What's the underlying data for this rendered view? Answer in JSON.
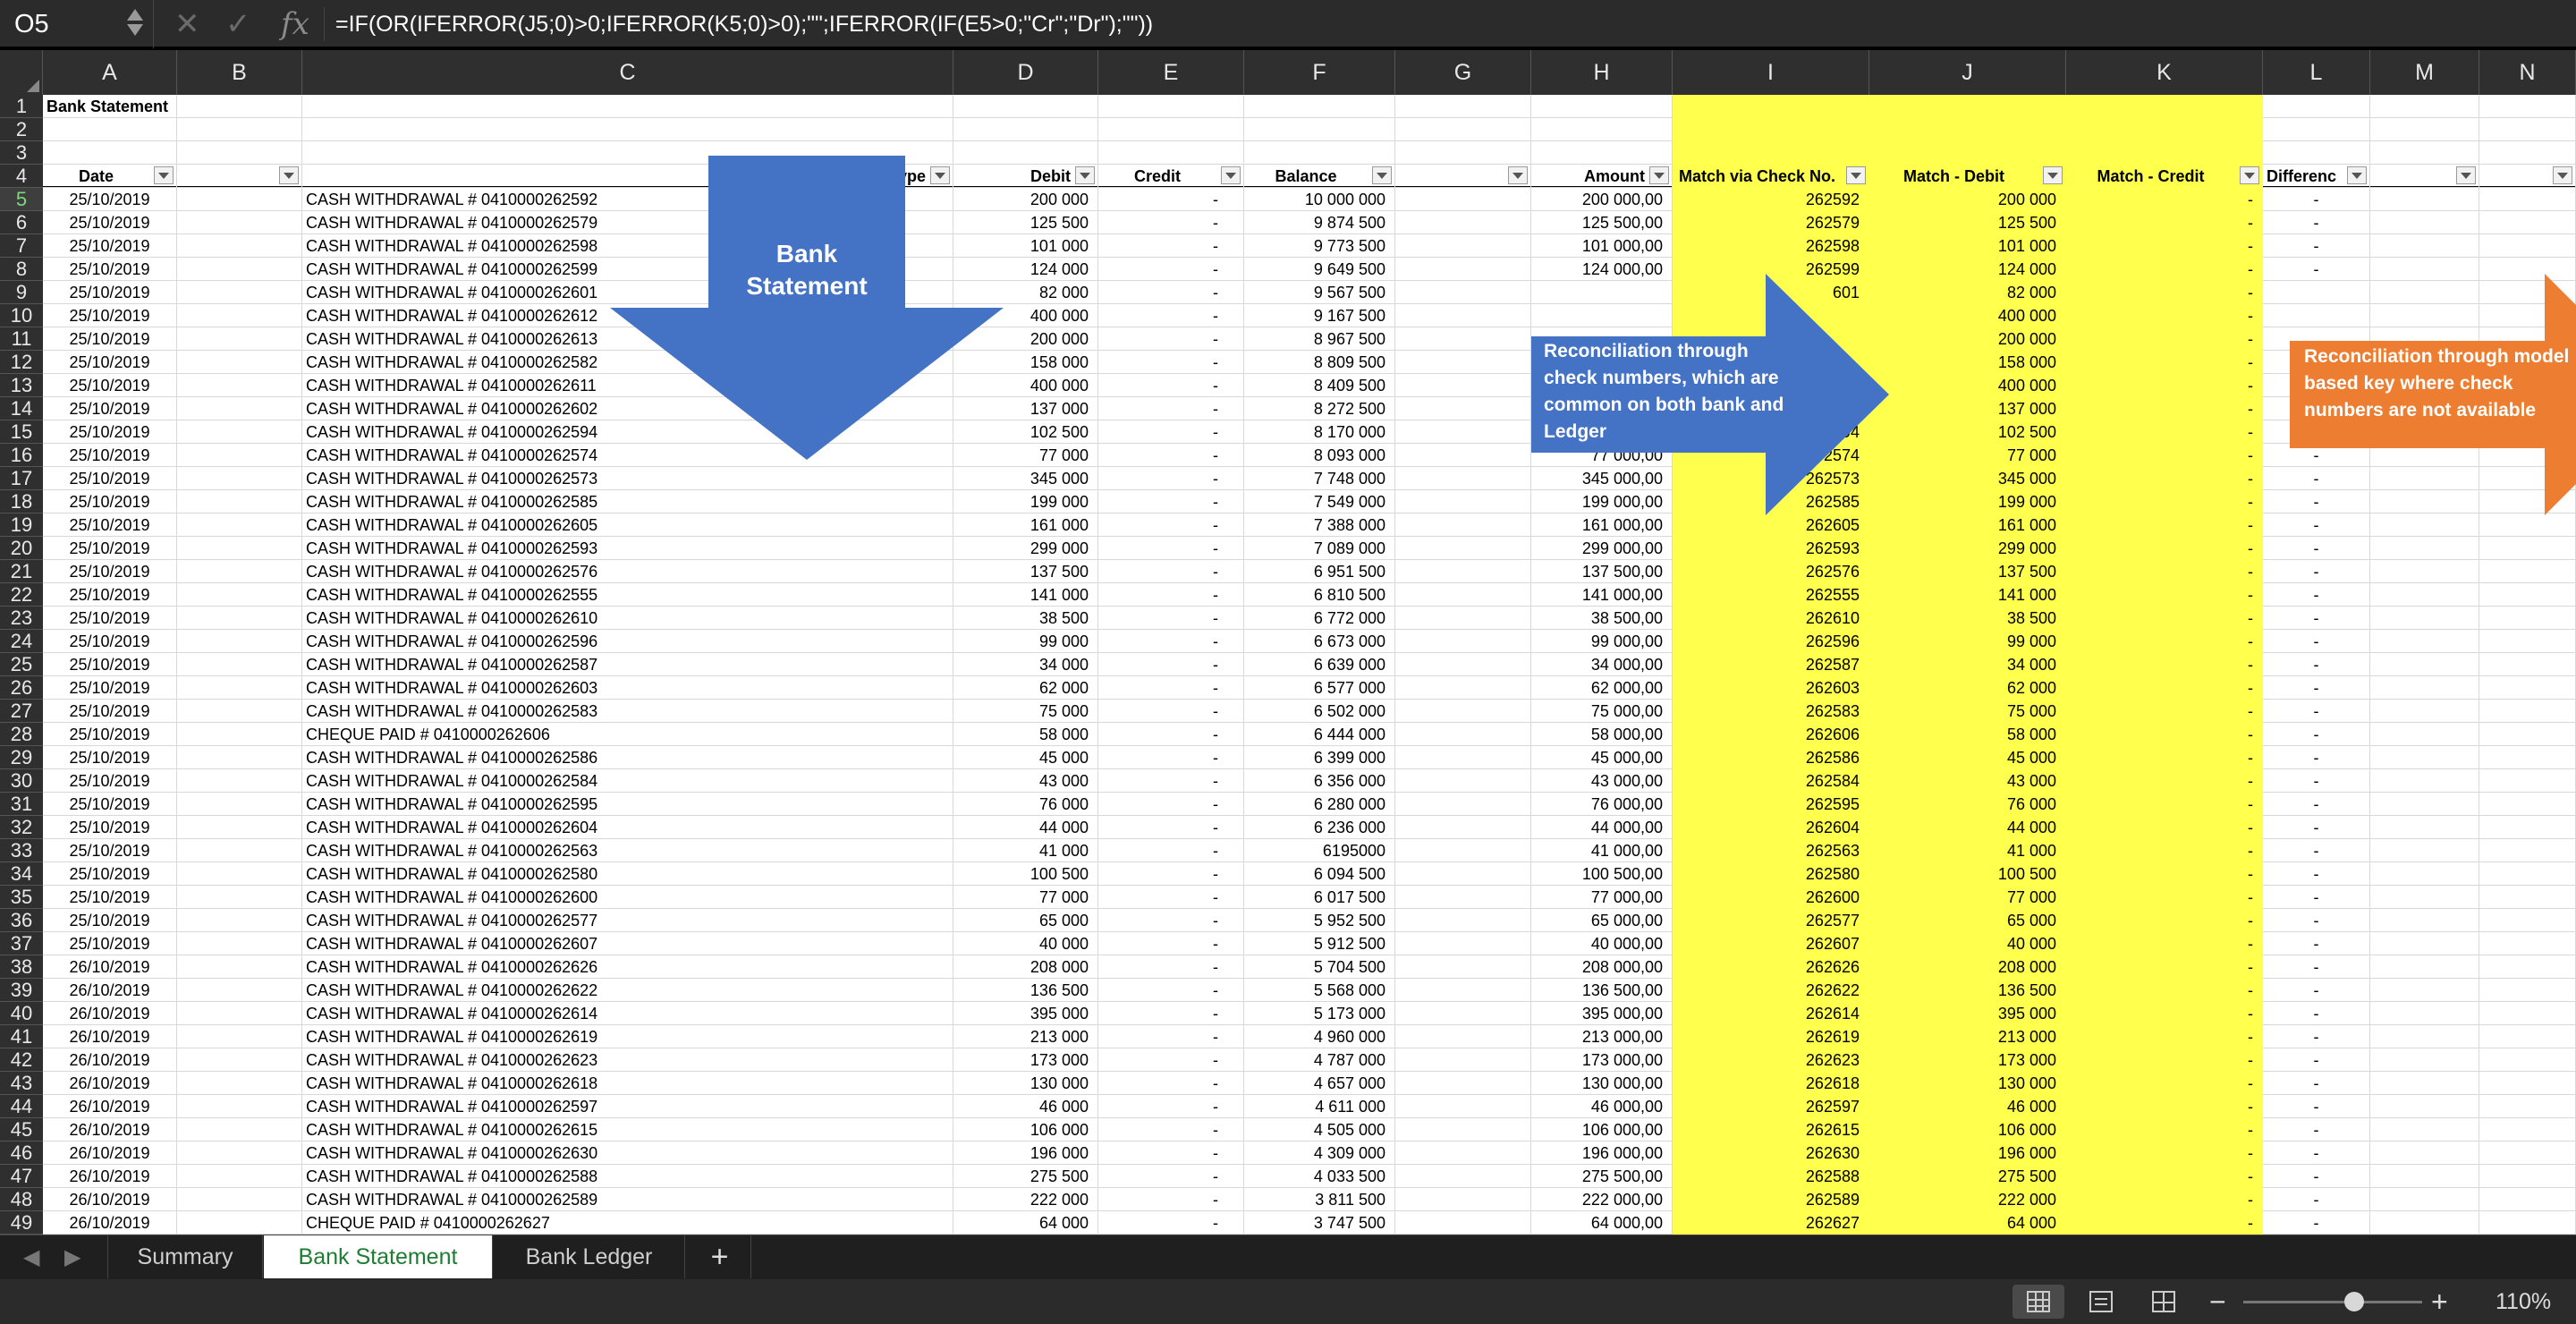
{
  "formula_bar": {
    "name_box": "O5",
    "formula": "=IF(OR(IFERROR(J5;0)>0;IFERROR(K5;0)>0);\"\";IFERROR(IF(E5>0;\"Cr\";\"Dr\");\"\"))"
  },
  "icons": {
    "cancel": "✕",
    "enter": "✓",
    "fx": "fx",
    "prev": "◀",
    "next": "▶",
    "add": "+",
    "zoom_out": "−",
    "zoom_in": "+"
  },
  "columns": [
    "A",
    "B",
    "C",
    "D",
    "E",
    "F",
    "G",
    "H",
    "I",
    "J",
    "K",
    "L",
    "M",
    "N"
  ],
  "active_cell": "O5",
  "title_cell": "Bank Statement",
  "headers": {
    "date": "Date",
    "transaction_type": "Transaction Type",
    "debit": "Debit",
    "credit": "Credit",
    "balance": "Balance",
    "amount": "Amount",
    "match_check": "Match via Check No.",
    "match_debit": "Match - Debit",
    "match_credit": "Match - Credit",
    "difference": "Differenc"
  },
  "rows": [
    {
      "r": "5",
      "date": "25/10/2019",
      "desc": "CASH WITHDRAWAL # 0410000262592",
      "debit": "200 000",
      "credit": "-",
      "balance": "10 000 000",
      "amount": "200 000,00",
      "check": "262592",
      "mdebit": "200 000",
      "mcredit": "-",
      "diff": "-"
    },
    {
      "r": "6",
      "date": "25/10/2019",
      "desc": "CASH WITHDRAWAL # 0410000262579",
      "debit": "125 500",
      "credit": "-",
      "balance": "9 874 500",
      "amount": "125 500,00",
      "check": "262579",
      "mdebit": "125 500",
      "mcredit": "-",
      "diff": "-"
    },
    {
      "r": "7",
      "date": "25/10/2019",
      "desc": "CASH WITHDRAWAL # 0410000262598",
      "debit": "101 000",
      "credit": "-",
      "balance": "9 773 500",
      "amount": "101 000,00",
      "check": "262598",
      "mdebit": "101 000",
      "mcredit": "-",
      "diff": "-"
    },
    {
      "r": "8",
      "date": "25/10/2019",
      "desc": "CASH WITHDRAWAL # 0410000262599",
      "debit": "124 000",
      "credit": "-",
      "balance": "9 649 500",
      "amount": "124 000,00",
      "check": "262599",
      "mdebit": "124 000",
      "mcredit": "-",
      "diff": "-"
    },
    {
      "r": "9",
      "date": "25/10/2019",
      "desc": "CASH WITHDRAWAL # 0410000262601",
      "debit": "82 000",
      "credit": "-",
      "balance": "9 567 500",
      "amount": "",
      "check": "601",
      "mdebit": "82 000",
      "mcredit": "-",
      "diff": ""
    },
    {
      "r": "10",
      "date": "25/10/2019",
      "desc": "CASH WITHDRAWAL # 0410000262612",
      "debit": "400 000",
      "credit": "-",
      "balance": "9 167 500",
      "amount": "",
      "check": "",
      "mdebit": "400 000",
      "mcredit": "-",
      "diff": ""
    },
    {
      "r": "11",
      "date": "25/10/2019",
      "desc": "CASH WITHDRAWAL # 0410000262613",
      "debit": "200 000",
      "credit": "-",
      "balance": "8 967 500",
      "amount": "",
      "check": "",
      "mdebit": "200 000",
      "mcredit": "-",
      "diff": ""
    },
    {
      "r": "12",
      "date": "25/10/2019",
      "desc": "CASH WITHDRAWAL # 0410000262582",
      "debit": "158 000",
      "credit": "-",
      "balance": "8 809 500",
      "amount": "",
      "check": "",
      "mdebit": "158 000",
      "mcredit": "-",
      "diff": ""
    },
    {
      "r": "13",
      "date": "25/10/2019",
      "desc": "CASH WITHDRAWAL # 0410000262611",
      "debit": "400 000",
      "credit": "-",
      "balance": "8 409 500",
      "amount": "",
      "check": "611",
      "mdebit": "400 000",
      "mcredit": "-",
      "diff": ""
    },
    {
      "r": "14",
      "date": "25/10/2019",
      "desc": "CASH WITHDRAWAL # 0410000262602",
      "debit": "137 000",
      "credit": "-",
      "balance": "8 272 500",
      "amount": "137 000,00",
      "check": "262602",
      "mdebit": "137 000",
      "mcredit": "-",
      "diff": "-"
    },
    {
      "r": "15",
      "date": "25/10/2019",
      "desc": "CASH WITHDRAWAL # 0410000262594",
      "debit": "102 500",
      "credit": "-",
      "balance": "8 170 000",
      "amount": "102 500,00",
      "check": "262594",
      "mdebit": "102 500",
      "mcredit": "-",
      "diff": "-"
    },
    {
      "r": "16",
      "date": "25/10/2019",
      "desc": "CASH WITHDRAWAL # 0410000262574",
      "debit": "77 000",
      "credit": "-",
      "balance": "8 093 000",
      "amount": "77 000,00",
      "check": "262574",
      "mdebit": "77 000",
      "mcredit": "-",
      "diff": "-"
    },
    {
      "r": "17",
      "date": "25/10/2019",
      "desc": "CASH WITHDRAWAL # 0410000262573",
      "debit": "345 000",
      "credit": "-",
      "balance": "7 748 000",
      "amount": "345 000,00",
      "check": "262573",
      "mdebit": "345 000",
      "mcredit": "-",
      "diff": "-"
    },
    {
      "r": "18",
      "date": "25/10/2019",
      "desc": "CASH WITHDRAWAL # 0410000262585",
      "debit": "199 000",
      "credit": "-",
      "balance": "7 549 000",
      "amount": "199 000,00",
      "check": "262585",
      "mdebit": "199 000",
      "mcredit": "-",
      "diff": "-"
    },
    {
      "r": "19",
      "date": "25/10/2019",
      "desc": "CASH WITHDRAWAL # 0410000262605",
      "debit": "161 000",
      "credit": "-",
      "balance": "7 388 000",
      "amount": "161 000,00",
      "check": "262605",
      "mdebit": "161 000",
      "mcredit": "-",
      "diff": "-"
    },
    {
      "r": "20",
      "date": "25/10/2019",
      "desc": "CASH WITHDRAWAL # 0410000262593",
      "debit": "299 000",
      "credit": "-",
      "balance": "7 089 000",
      "amount": "299 000,00",
      "check": "262593",
      "mdebit": "299 000",
      "mcredit": "-",
      "diff": "-"
    },
    {
      "r": "21",
      "date": "25/10/2019",
      "desc": "CASH WITHDRAWAL # 0410000262576",
      "debit": "137 500",
      "credit": "-",
      "balance": "6 951 500",
      "amount": "137 500,00",
      "check": "262576",
      "mdebit": "137 500",
      "mcredit": "-",
      "diff": "-"
    },
    {
      "r": "22",
      "date": "25/10/2019",
      "desc": "CASH WITHDRAWAL # 0410000262555",
      "debit": "141 000",
      "credit": "-",
      "balance": "6 810 500",
      "amount": "141 000,00",
      "check": "262555",
      "mdebit": "141 000",
      "mcredit": "-",
      "diff": "-"
    },
    {
      "r": "23",
      "date": "25/10/2019",
      "desc": "CASH WITHDRAWAL # 0410000262610",
      "debit": "38 500",
      "credit": "-",
      "balance": "6 772 000",
      "amount": "38 500,00",
      "check": "262610",
      "mdebit": "38 500",
      "mcredit": "-",
      "diff": "-"
    },
    {
      "r": "24",
      "date": "25/10/2019",
      "desc": "CASH WITHDRAWAL # 0410000262596",
      "debit": "99 000",
      "credit": "-",
      "balance": "6 673 000",
      "amount": "99 000,00",
      "check": "262596",
      "mdebit": "99 000",
      "mcredit": "-",
      "diff": "-"
    },
    {
      "r": "25",
      "date": "25/10/2019",
      "desc": "CASH WITHDRAWAL # 0410000262587",
      "debit": "34 000",
      "credit": "-",
      "balance": "6 639 000",
      "amount": "34 000,00",
      "check": "262587",
      "mdebit": "34 000",
      "mcredit": "-",
      "diff": "-"
    },
    {
      "r": "26",
      "date": "25/10/2019",
      "desc": "CASH WITHDRAWAL # 0410000262603",
      "debit": "62 000",
      "credit": "-",
      "balance": "6 577 000",
      "amount": "62 000,00",
      "check": "262603",
      "mdebit": "62 000",
      "mcredit": "-",
      "diff": "-"
    },
    {
      "r": "27",
      "date": "25/10/2019",
      "desc": "CASH WITHDRAWAL # 0410000262583",
      "debit": "75 000",
      "credit": "-",
      "balance": "6 502 000",
      "amount": "75 000,00",
      "check": "262583",
      "mdebit": "75 000",
      "mcredit": "-",
      "diff": "-"
    },
    {
      "r": "28",
      "date": "25/10/2019",
      "desc": "CHEQUE PAID # 0410000262606",
      "debit": "58 000",
      "credit": "-",
      "balance": "6 444 000",
      "amount": "58 000,00",
      "check": "262606",
      "mdebit": "58 000",
      "mcredit": "-",
      "diff": "-"
    },
    {
      "r": "29",
      "date": "25/10/2019",
      "desc": "CASH WITHDRAWAL # 0410000262586",
      "debit": "45 000",
      "credit": "-",
      "balance": "6 399 000",
      "amount": "45 000,00",
      "check": "262586",
      "mdebit": "45 000",
      "mcredit": "-",
      "diff": "-"
    },
    {
      "r": "30",
      "date": "25/10/2019",
      "desc": "CASH WITHDRAWAL # 0410000262584",
      "debit": "43 000",
      "credit": "-",
      "balance": "6 356 000",
      "amount": "43 000,00",
      "check": "262584",
      "mdebit": "43 000",
      "mcredit": "-",
      "diff": "-"
    },
    {
      "r": "31",
      "date": "25/10/2019",
      "desc": "CASH WITHDRAWAL # 0410000262595",
      "debit": "76 000",
      "credit": "-",
      "balance": "6 280 000",
      "amount": "76 000,00",
      "check": "262595",
      "mdebit": "76 000",
      "mcredit": "-",
      "diff": "-"
    },
    {
      "r": "32",
      "date": "25/10/2019",
      "desc": "CASH WITHDRAWAL # 0410000262604",
      "debit": "44 000",
      "credit": "-",
      "balance": "6 236 000",
      "amount": "44 000,00",
      "check": "262604",
      "mdebit": "44 000",
      "mcredit": "-",
      "diff": "-"
    },
    {
      "r": "33",
      "date": "25/10/2019",
      "desc": "CASH WITHDRAWAL # 0410000262563",
      "debit": "41 000",
      "credit": "-",
      "balance": "6195000",
      "amount": "41 000,00",
      "check": "262563",
      "mdebit": "41 000",
      "mcredit": "-",
      "diff": "-"
    },
    {
      "r": "34",
      "date": "25/10/2019",
      "desc": "CASH WITHDRAWAL # 0410000262580",
      "debit": "100 500",
      "credit": "-",
      "balance": "6 094 500",
      "amount": "100 500,00",
      "check": "262580",
      "mdebit": "100 500",
      "mcredit": "-",
      "diff": "-"
    },
    {
      "r": "35",
      "date": "25/10/2019",
      "desc": "CASH WITHDRAWAL # 0410000262600",
      "debit": "77 000",
      "credit": "-",
      "balance": "6 017 500",
      "amount": "77 000,00",
      "check": "262600",
      "mdebit": "77 000",
      "mcredit": "-",
      "diff": "-"
    },
    {
      "r": "36",
      "date": "25/10/2019",
      "desc": "CASH WITHDRAWAL # 0410000262577",
      "debit": "65 000",
      "credit": "-",
      "balance": "5 952 500",
      "amount": "65 000,00",
      "check": "262577",
      "mdebit": "65 000",
      "mcredit": "-",
      "diff": "-"
    },
    {
      "r": "37",
      "date": "25/10/2019",
      "desc": "CASH WITHDRAWAL # 0410000262607",
      "debit": "40 000",
      "credit": "-",
      "balance": "5 912 500",
      "amount": "40 000,00",
      "check": "262607",
      "mdebit": "40 000",
      "mcredit": "-",
      "diff": "-"
    },
    {
      "r": "38",
      "date": "26/10/2019",
      "desc": "CASH WITHDRAWAL # 0410000262626",
      "debit": "208 000",
      "credit": "-",
      "balance": "5 704 500",
      "amount": "208 000,00",
      "check": "262626",
      "mdebit": "208 000",
      "mcredit": "-",
      "diff": "-"
    },
    {
      "r": "39",
      "date": "26/10/2019",
      "desc": "CASH WITHDRAWAL # 0410000262622",
      "debit": "136 500",
      "credit": "-",
      "balance": "5 568 000",
      "amount": "136 500,00",
      "check": "262622",
      "mdebit": "136 500",
      "mcredit": "-",
      "diff": "-"
    },
    {
      "r": "40",
      "date": "26/10/2019",
      "desc": "CASH WITHDRAWAL # 0410000262614",
      "debit": "395 000",
      "credit": "-",
      "balance": "5 173 000",
      "amount": "395 000,00",
      "check": "262614",
      "mdebit": "395 000",
      "mcredit": "-",
      "diff": "-"
    },
    {
      "r": "41",
      "date": "26/10/2019",
      "desc": "CASH WITHDRAWAL # 0410000262619",
      "debit": "213 000",
      "credit": "-",
      "balance": "4 960 000",
      "amount": "213 000,00",
      "check": "262619",
      "mdebit": "213 000",
      "mcredit": "-",
      "diff": "-"
    },
    {
      "r": "42",
      "date": "26/10/2019",
      "desc": "CASH WITHDRAWAL # 0410000262623",
      "debit": "173 000",
      "credit": "-",
      "balance": "4 787 000",
      "amount": "173 000,00",
      "check": "262623",
      "mdebit": "173 000",
      "mcredit": "-",
      "diff": "-"
    },
    {
      "r": "43",
      "date": "26/10/2019",
      "desc": "CASH WITHDRAWAL # 0410000262618",
      "debit": "130 000",
      "credit": "-",
      "balance": "4 657 000",
      "amount": "130 000,00",
      "check": "262618",
      "mdebit": "130 000",
      "mcredit": "-",
      "diff": "-"
    },
    {
      "r": "44",
      "date": "26/10/2019",
      "desc": "CASH WITHDRAWAL # 0410000262597",
      "debit": "46 000",
      "credit": "-",
      "balance": "4 611 000",
      "amount": "46 000,00",
      "check": "262597",
      "mdebit": "46 000",
      "mcredit": "-",
      "diff": "-"
    },
    {
      "r": "45",
      "date": "26/10/2019",
      "desc": "CASH WITHDRAWAL # 0410000262615",
      "debit": "106 000",
      "credit": "-",
      "balance": "4 505 000",
      "amount": "106 000,00",
      "check": "262615",
      "mdebit": "106 000",
      "mcredit": "-",
      "diff": "-"
    },
    {
      "r": "46",
      "date": "26/10/2019",
      "desc": "CASH WITHDRAWAL # 0410000262630",
      "debit": "196 000",
      "credit": "-",
      "balance": "4 309 000",
      "amount": "196 000,00",
      "check": "262630",
      "mdebit": "196 000",
      "mcredit": "-",
      "diff": "-"
    },
    {
      "r": "47",
      "date": "26/10/2019",
      "desc": "CASH WITHDRAWAL # 0410000262588",
      "debit": "275 500",
      "credit": "-",
      "balance": "4 033 500",
      "amount": "275 500,00",
      "check": "262588",
      "mdebit": "275 500",
      "mcredit": "-",
      "diff": "-"
    },
    {
      "r": "48",
      "date": "26/10/2019",
      "desc": "CASH WITHDRAWAL # 0410000262589",
      "debit": "222 000",
      "credit": "-",
      "balance": "3 811 500",
      "amount": "222 000,00",
      "check": "262589",
      "mdebit": "222 000",
      "mcredit": "-",
      "diff": "-"
    },
    {
      "r": "49",
      "date": "26/10/2019",
      "desc": "CHEQUE PAID # 0410000262627",
      "debit": "64 000",
      "credit": "-",
      "balance": "3 747 500",
      "amount": "64 000,00",
      "check": "262627",
      "mdebit": "64 000",
      "mcredit": "-",
      "diff": "-"
    }
  ],
  "shapes": {
    "bank_statement": {
      "line1": "Bank",
      "line2": "Statement",
      "color": "#4472c4"
    },
    "check_recon": {
      "text": "Reconciliation through check numbers, which are common on both bank and Ledger",
      "color": "#4472c4"
    },
    "model_recon": {
      "text": "Reconciliation through model based key where check numbers are not available",
      "color": "#ed7d31"
    }
  },
  "sheet_tabs": {
    "summary": "Summary",
    "bank_statement": "Bank Statement",
    "bank_ledger": "Bank Ledger",
    "active": "Bank Statement"
  },
  "status_bar": {
    "zoom": "110%",
    "zoom_fraction": 0.62
  },
  "colors": {
    "highlight": "#ffff4d",
    "active_tab_text": "#1e7d32"
  }
}
